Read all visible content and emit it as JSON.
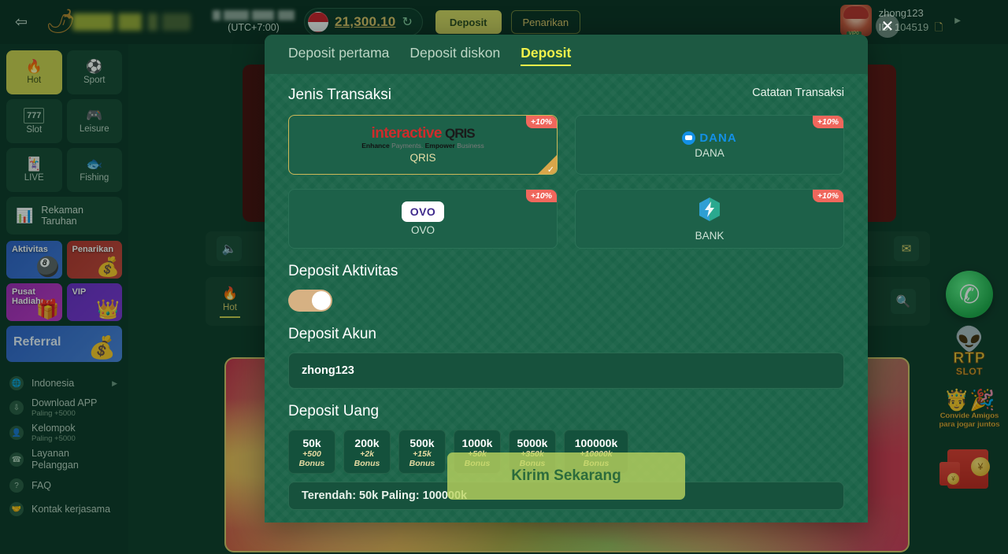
{
  "topbar": {
    "back_icon": "back-arrow-icon",
    "logo_icon": "dragon-logo-icon",
    "utc_label": "(UTC+7:00)",
    "flag_icon": "indonesia-flag-icon",
    "balance": "21,300.10",
    "refresh_icon": "refresh-icon",
    "deposit_label": "Deposit",
    "withdraw_label": "Penarikan",
    "username": "zhong123",
    "user_id": "ID: 104519",
    "copy_icon": "copy-icon",
    "caret_icon": "chevron-right-icon",
    "avatar_icon": "user-avatar"
  },
  "sidebar": {
    "nav": [
      {
        "label": "Hot",
        "icon": "flame-icon",
        "active": true
      },
      {
        "label": "Sport",
        "icon": "basketball-icon",
        "active": false
      },
      {
        "label": "Slot",
        "icon": "slot-777-icon",
        "active": false
      },
      {
        "label": "Leisure",
        "icon": "gamepad-icon",
        "active": false
      },
      {
        "label": "LIVE",
        "icon": "cards-icon",
        "active": false
      },
      {
        "label": "Fishing",
        "icon": "fish-icon",
        "active": false
      }
    ],
    "bet_record": {
      "label": "Rekaman Taruhan",
      "icon": "bet-record-icon"
    },
    "promos": [
      {
        "label": "Aktivitas",
        "icon": "activity-wheel-icon"
      },
      {
        "label": "Penarikan",
        "icon": "money-stack-icon"
      },
      {
        "label": "Pusat Hadiah",
        "icon": "gift-box-icon"
      },
      {
        "label": "VIP",
        "icon": "crown-icon"
      }
    ],
    "referral": {
      "label": "Referral",
      "icon": "money-bag-icon"
    },
    "menu": [
      {
        "label": "Indonesia",
        "sub": "",
        "icon": "globe-icon",
        "caret": "▶"
      },
      {
        "label": "Download APP",
        "sub": "Paling +5000",
        "icon": "download-icon",
        "caret": ""
      },
      {
        "label": "Kelompok",
        "sub": "Paling +5000",
        "icon": "group-icon",
        "caret": ""
      },
      {
        "label": "Layanan Pelanggan",
        "sub": "",
        "icon": "headset-icon",
        "caret": ""
      },
      {
        "label": "FAQ",
        "sub": "",
        "icon": "question-icon",
        "caret": ""
      },
      {
        "label": "Kontak kerjasama",
        "sub": "",
        "icon": "handshake-icon",
        "caret": ""
      }
    ]
  },
  "background": {
    "speaker_icon": "speaker-icon",
    "mail_icon": "mail-icon",
    "search_icon": "search-icon",
    "tab_hot_label": "Hot",
    "tab_hot_icon": "flame-icon"
  },
  "floating": {
    "whatsapp_icon": "whatsapp-icon",
    "rtp": {
      "astronaut_icon": "astronaut-icon",
      "word": "RTP",
      "sub": "SLOT"
    },
    "invite": {
      "art_icon": "invite-friends-icon",
      "line1": "Convide Amigos",
      "line2": "para jogar juntos"
    },
    "envelope_icon": "red-envelope-icon",
    "coin_glyph": "¥",
    "coin_glyph_small": "¥"
  },
  "modal": {
    "tabs": [
      {
        "label": "Deposit pertama",
        "active": false
      },
      {
        "label": "Deposit diskon",
        "active": false
      },
      {
        "label": "Deposit",
        "active": true
      }
    ],
    "close_icon": "close-icon",
    "section_transaksi": "Jenis Transaksi",
    "record_link": "Catatan Transaksi",
    "methods": [
      {
        "name": "QRIS",
        "bonus": "+10%",
        "selected": true,
        "logo": "qris-logo",
        "qris_word": "interactive",
        "qris_mark": "QRIS",
        "tag_a": "Enhance",
        "tag_b": " Payments. ",
        "tag_c": "Empower",
        "tag_d": " Business"
      },
      {
        "name": "DANA",
        "bonus": "+10%",
        "selected": false,
        "logo": "dana-logo",
        "dana_word": "DANA"
      },
      {
        "name": "OVO",
        "bonus": "+10%",
        "selected": false,
        "logo": "ovo-logo",
        "ovo_word": "OVO"
      },
      {
        "name": "BANK",
        "bonus": "+10%",
        "selected": false,
        "logo": "bank-logo",
        "bank_glyph": "⚡"
      }
    ],
    "section_aktivitas": "Deposit Aktivitas",
    "toggle_on": true,
    "section_akun": "Deposit Akun",
    "account_value": "zhong123",
    "section_uang": "Deposit Uang",
    "amounts": [
      {
        "amount": "50k",
        "bonus": "+500",
        "bonus_label": "Bonus"
      },
      {
        "amount": "200k",
        "bonus": "+2k",
        "bonus_label": "Bonus"
      },
      {
        "amount": "500k",
        "bonus": "+15k",
        "bonus_label": "Bonus"
      },
      {
        "amount": "1000k",
        "bonus": "+50k",
        "bonus_label": "Bonus"
      },
      {
        "amount": "5000k",
        "bonus": "+350k",
        "bonus_label": "Bonus"
      },
      {
        "amount": "100000k",
        "bonus": "+10000k",
        "bonus_label": "Bonus"
      }
    ],
    "send_label": "Kirim Sekarang",
    "range_text": "Terendah: 50k Paling: 100000k"
  },
  "colors": {
    "brand_green": "#1b6348",
    "accent_gold": "#e3c86a",
    "accent_yellow": "#f2f24a",
    "bonus_red": "#f0675c",
    "send_green": "#bed65f"
  }
}
